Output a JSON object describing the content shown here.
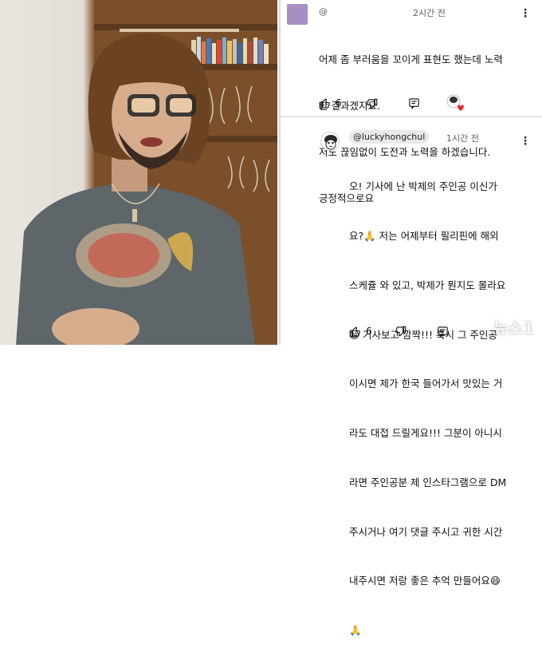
{
  "top_comment": {
    "handle": "@",
    "time": "2시간 전",
    "lines": [
      "어제 좀 부러움을 꼬이게 표현도 했는데 노력",
      "한 결과겠지요.",
      "저도 끊임없이 도전과 노력을 하겠습니다.",
      "긍정적으로요"
    ],
    "likes": "6",
    "avatar_color": "#a78fc4"
  },
  "reply": {
    "handle": "@luckyhongchul",
    "time": "1시간 전",
    "lines": [
      "오! 기사에 난 박제의 주인공 이신가",
      "요?🙏 저는 어제부터 필리핀에 해외",
      "스케쥴 와 있고, 박제가 뭔지도 몰라요",
      "😄 기사보고 깜짝!!! 혹시 그 주인공",
      "이시면 제가 한국 들어가서 맛있는 거",
      "라도 대접 드릴게요!!! 그분이 아니시",
      "라면 주인공분 제 인스타그램으로 DM",
      "주시거나 여기 댓글 주시고 귀한 시간",
      "내주시면 저랑 좋은 추억 만들어요😄",
      "🙏"
    ],
    "likes": "6"
  },
  "watermark": "뉴스1",
  "icons": {
    "like": "thumbs-up-icon",
    "dislike": "thumbs-down-icon",
    "reply": "reply-comment-icon",
    "creator_heart": "creator-heart-icon",
    "more": "more-vertical-icon"
  }
}
